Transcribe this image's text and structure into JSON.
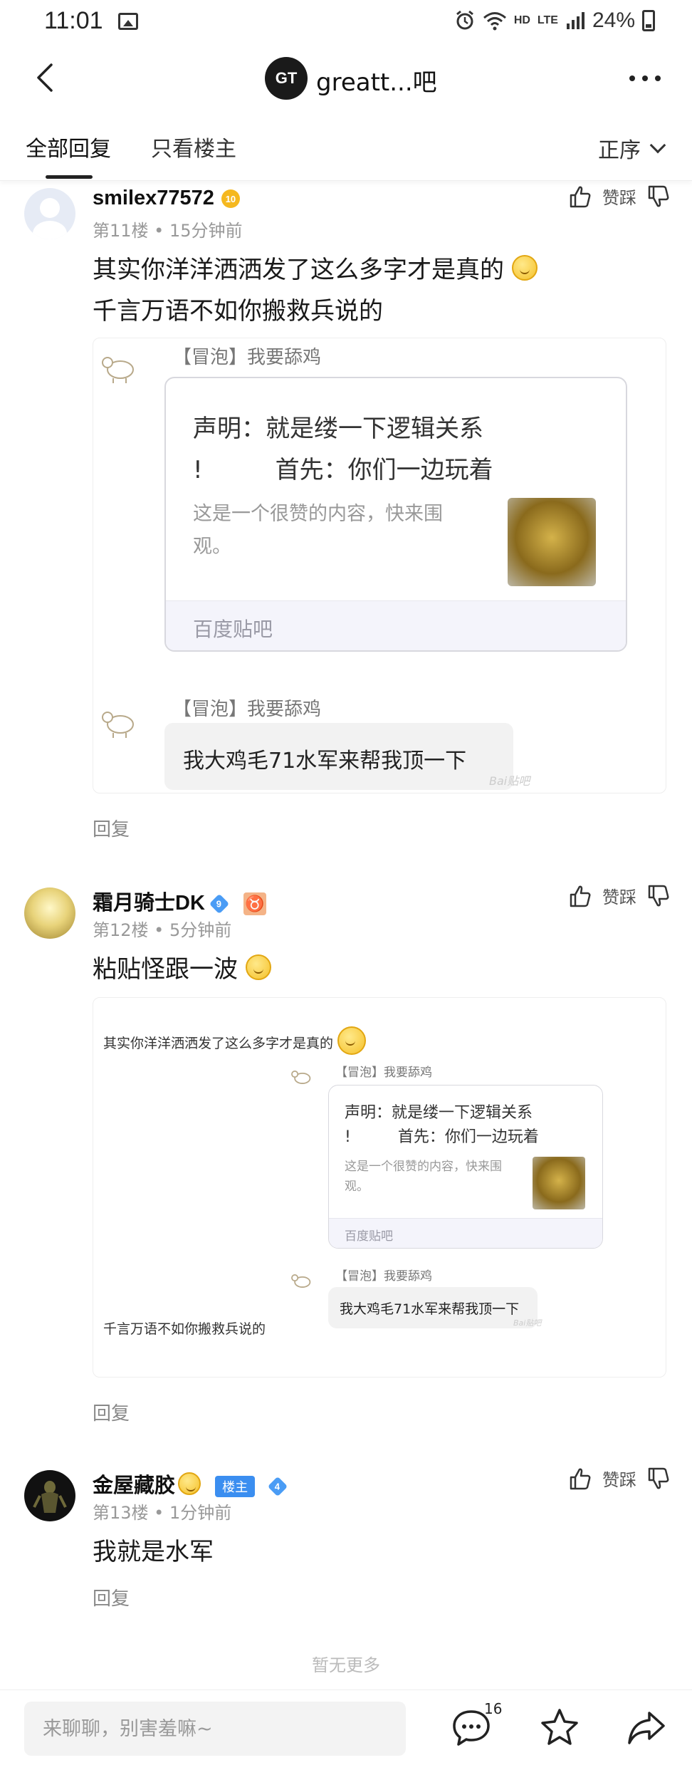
{
  "status_bar": {
    "time": "11:01",
    "network": "HD",
    "lte": "LTE",
    "battery": "24%"
  },
  "header": {
    "forum_logo": "GT",
    "forum_title": "greatt...吧"
  },
  "tabs": {
    "all_replies": "全部回复",
    "only_op": "只看楼主",
    "sort": "正序"
  },
  "posts": [
    {
      "username": "smilex77572",
      "level": "10",
      "meta": "第11楼 • 15分钟前",
      "content_line1": "其实你洋洋洒洒发了这么多字才是真的",
      "content_line2": "千言万语不如你搬救兵说的",
      "quote_label_1": "【冒泡】我要舔鸡",
      "card_title_1": "声明：就是缕一下逻辑关系",
      "card_title_2": "!　　　首先：你们一边玩着",
      "card_desc_1": "这是一个很赞的内容，快来围",
      "card_desc_2": "观。",
      "card_footer": "百度贴吧",
      "quote_label_2": "【冒泡】我要舔鸡",
      "bubble_text": "我大鸡毛71水军来帮我顶一下",
      "watermark": "Bai贴吧",
      "reply": "回复",
      "vote": "赞踩"
    },
    {
      "username": "霜月骑士DK",
      "level": "9",
      "meta": "第12楼 • 5分钟前",
      "content": "粘贴怪跟一波",
      "inner_text_top": "其实你洋洋洒洒发了这么多字才是真的",
      "inner_text_bottom": "千言万语不如你搬救兵说的",
      "quote_label_1": "【冒泡】我要舔鸡",
      "card_title_1": "声明：就是缕一下逻辑关系",
      "card_title_2": "!　　　首先：你们一边玩着",
      "card_desc_1": "这是一个很赞的内容，快来围",
      "card_desc_2": "观。",
      "card_footer": "百度贴吧",
      "quote_label_2": "【冒泡】我要舔鸡",
      "bubble_text": "我大鸡毛71水军来帮我顶一下",
      "watermark": "Bai贴吧",
      "reply": "回复",
      "vote": "赞踩"
    },
    {
      "username": "金屋藏胶",
      "badge": "楼主",
      "level": "4",
      "meta": "第13楼 • 1分钟前",
      "content": "我就是水军",
      "reply": "回复",
      "vote": "赞踩"
    }
  ],
  "no_more": "暂无更多",
  "bottom_bar": {
    "comment_placeholder": "来聊聊，别害羞嘛~",
    "comment_count": "16"
  },
  "colors": {
    "level_gold": "#f5b81f",
    "level_blue": "#4a9cf5",
    "op_badge": "#3b8ef0"
  }
}
